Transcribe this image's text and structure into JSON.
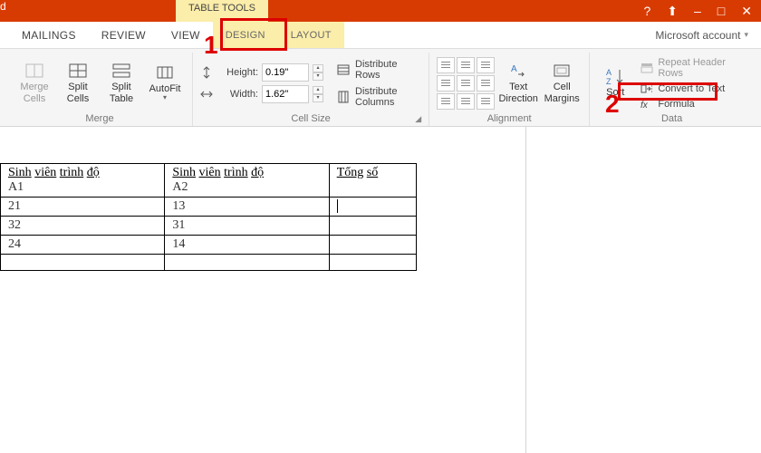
{
  "titlebar": {
    "tabletools": "TABLE TOOLS",
    "help": "?",
    "fullscreen": "⬆",
    "minimize": "–",
    "restore": "□",
    "close": "✕"
  },
  "tabs": {
    "mailings": "MAILINGS",
    "review": "REVIEW",
    "view": "VIEW",
    "design": "DESIGN",
    "layout": "LAYOUT",
    "account": "Microsoft account"
  },
  "ribbon": {
    "merge": {
      "merge_cells": "Merge Cells",
      "split_cells": "Split Cells",
      "split_table": "Split Table",
      "autofit": "AutoFit",
      "group": "Merge"
    },
    "cellsize": {
      "height_lbl": "Height:",
      "height_val": "0.19\"",
      "width_lbl": "Width:",
      "width_val": "1.62\"",
      "dist_rows": "Distribute Rows",
      "dist_cols": "Distribute Columns",
      "group": "Cell Size"
    },
    "alignment": {
      "text_dir": "Text Direction",
      "cell_margins": "Cell Margins",
      "group": "Alignment"
    },
    "sort": {
      "label": "Sort"
    },
    "data": {
      "repeat": "Repeat Header Rows",
      "convert": "Convert to Text",
      "formula": "Formula",
      "group": "Data"
    }
  },
  "table": {
    "headers": [
      "Sinh viên trình độ A1",
      "Sinh viên trình độ A2",
      "Tổng số"
    ],
    "rows": [
      [
        "21",
        "13",
        ""
      ],
      [
        "32",
        "31",
        ""
      ],
      [
        "24",
        "14",
        ""
      ],
      [
        "",
        "",
        ""
      ]
    ]
  },
  "annotations": {
    "one": "1",
    "two": "2"
  }
}
